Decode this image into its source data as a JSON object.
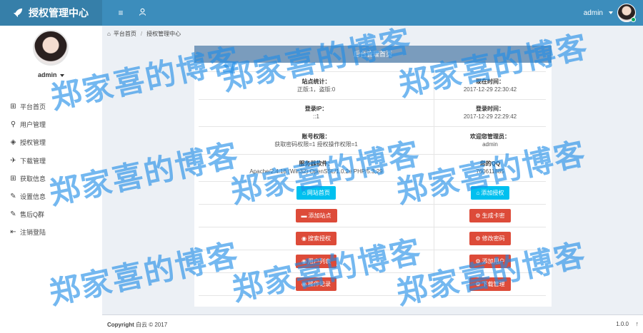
{
  "header": {
    "title": "授权管理中心",
    "menu_icon": "bars-icon",
    "user_icon": "user-icon",
    "username": "admin"
  },
  "sidebar": {
    "username": "admin",
    "items": [
      {
        "label": "平台首页",
        "icon": "grid-icon"
      },
      {
        "label": "用户管理",
        "icon": "user-icon"
      },
      {
        "label": "授权管理",
        "icon": "layers-icon"
      },
      {
        "label": "下载管理",
        "icon": "download-icon"
      },
      {
        "label": "获取信息",
        "icon": "grid-icon"
      },
      {
        "label": "设置信息",
        "icon": "edit-icon"
      },
      {
        "label": "售后Q群",
        "icon": "edit-icon"
      },
      {
        "label": "注销登陆",
        "icon": "logout-icon"
      }
    ]
  },
  "breadcrumb": {
    "home": "平台首页",
    "current": "授权管理中心"
  },
  "panel": {
    "title": "后台管理首页",
    "rows": [
      {
        "lk": "站点统计：",
        "lv": "正版:1，盗版:0",
        "rk": "现在时间：",
        "rv": "2017-12-29 22:30:42"
      },
      {
        "lk": "登录IP：",
        "lv": "::1",
        "rk": "登录时间：",
        "rv": "2017-12-29 22:29:42"
      },
      {
        "lk": "账号权限：",
        "lv": "获取密码权限=1 授权操作权限=1",
        "rk": "欢迎您管理员：",
        "rv": "admin"
      },
      {
        "lk": "服务器软件：",
        "lv": "Apache/2.4.18 (Win32) OpenSSL/1.0.2e PHP/5.3.29",
        "rk": "您的QQ",
        "rv": "760611885"
      }
    ],
    "buttons": [
      {
        "l": "网站首页",
        "lc": "blue",
        "li": "home-icon",
        "r": "添加授权",
        "rc": "blue",
        "ri": "home-icon"
      },
      {
        "l": "添加站点",
        "lc": "red",
        "li": "folder-icon",
        "r": "生成卡密",
        "rc": "red",
        "ri": "gear-icon"
      },
      {
        "l": "搜索授权",
        "lc": "red",
        "li": "globe-icon",
        "r": "修改密码",
        "rc": "red",
        "ri": "gear-icon"
      },
      {
        "l": "用户列表",
        "lc": "red",
        "li": "globe-icon",
        "r": "添加用户",
        "rc": "red",
        "ri": "gear-icon"
      },
      {
        "l": "操作记录",
        "lc": "red",
        "li": "globe-icon",
        "r": "下载管理",
        "rc": "red",
        "ri": "gear-icon"
      }
    ]
  },
  "footer": {
    "brand": "Copyright",
    "copyright": "白云 © 2017",
    "version": "1.0.0",
    "up_icon": "arrow-up-icon"
  },
  "watermark": "郑家喜的博客",
  "colors": {
    "header": "#3c8dbc",
    "logo_bg": "#367fa9",
    "panel_head": "#7a9cbd",
    "btn_blue": "#00c0ef",
    "btn_red": "#dd4b39",
    "watermark": "#1e8ce6"
  }
}
